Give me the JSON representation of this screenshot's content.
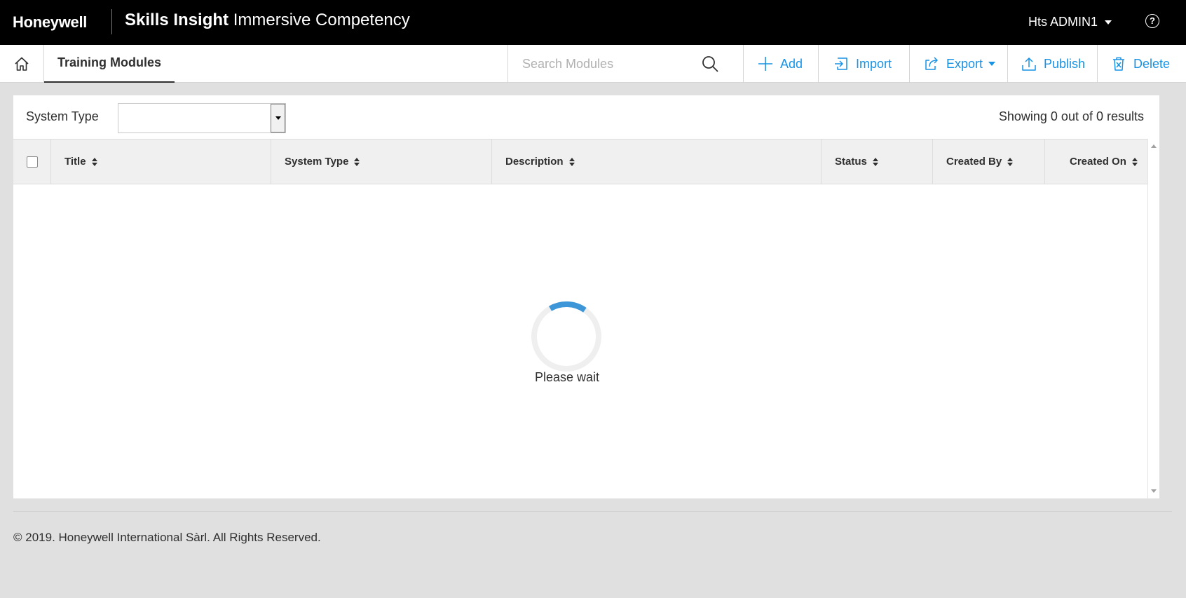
{
  "header": {
    "brand": "Honeywell",
    "app_title_strong": "Skills Insight",
    "app_title_rest": " Immersive Competency",
    "user_name": "Hts ADMIN1",
    "help_icon": "question-circle-icon",
    "help_glyph": "?"
  },
  "toolbar": {
    "page_title": "Training Modules",
    "search_placeholder": "Search Modules",
    "search_value": "",
    "add_label": "Add",
    "import_label": "Import",
    "export_label": "Export",
    "publish_label": "Publish",
    "delete_label": "Delete",
    "accent_color": "#1792e5"
  },
  "filter": {
    "label": "System Type",
    "selected_value": ""
  },
  "results_text": "Showing 0 out of 0 results",
  "table": {
    "columns": [
      "Title",
      "System Type",
      "Description",
      "Status",
      "Created By",
      "Created On"
    ],
    "rows": []
  },
  "loading": {
    "text": "Please wait",
    "progress": 0.18,
    "color": "#3c96d8"
  },
  "footer": {
    "copyright": "© 2019. Honeywell International Sàrl. All Rights Reserved."
  }
}
